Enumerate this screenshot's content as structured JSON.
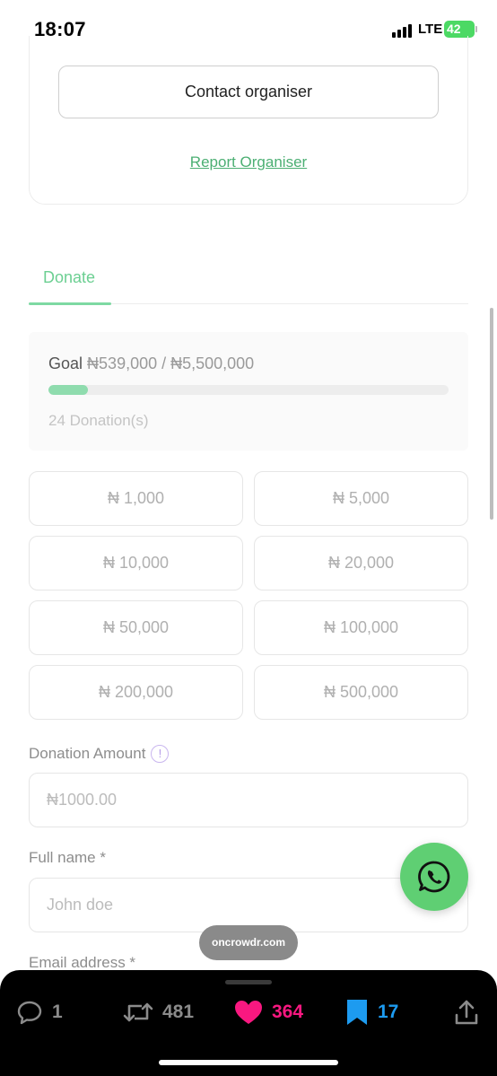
{
  "status_bar": {
    "time": "18:07",
    "network": "LTE",
    "battery": "42"
  },
  "organiser": {
    "contact_label": "Contact organiser",
    "report_label": "Report Organiser"
  },
  "tabs": [
    {
      "label": "Donate",
      "active": true
    }
  ],
  "goal": {
    "prefix": "Goal",
    "amount_text": "₦539,000 / ₦5,500,000",
    "progress_fraction": 0.098,
    "donations_text": "24 Donation(s)"
  },
  "amount_options": [
    "₦ 1,000",
    "₦ 5,000",
    "₦ 10,000",
    "₦ 20,000",
    "₦ 50,000",
    "₦ 100,000",
    "₦ 200,000",
    "₦ 500,000"
  ],
  "form": {
    "donation_amount_label": "Donation Amount",
    "info_glyph": "!",
    "donation_amount_placeholder": "₦1000.00",
    "full_name_label": "Full name *",
    "full_name_placeholder": "John doe",
    "email_label": "Email address *"
  },
  "url_pill": "oncrowdr.com",
  "bottom_actions": {
    "replies": "1",
    "reposts": "481",
    "likes": "364",
    "bookmarks": "17"
  },
  "colors": {
    "accent_green": "#6ccf92",
    "progress_fill": "#8fdcae",
    "whatsapp_green": "#5fcf73",
    "like_pink": "#f91880",
    "bookmark_blue": "#1d9bf0"
  },
  "icons": {
    "whatsapp": "whatsapp-icon",
    "reply": "reply-icon",
    "repost": "repost-icon",
    "like": "heart-icon",
    "bookmark": "bookmark-icon",
    "share": "share-icon",
    "info": "info-icon"
  }
}
